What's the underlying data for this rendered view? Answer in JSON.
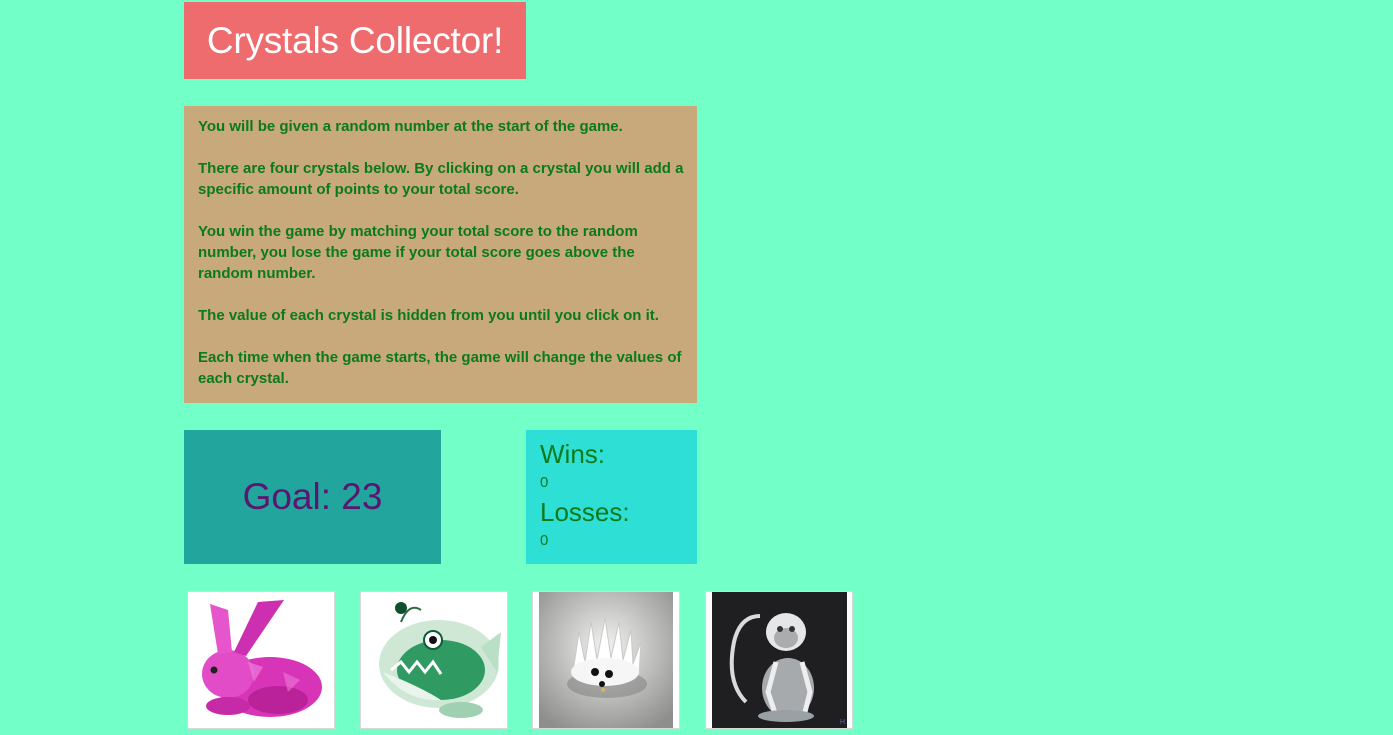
{
  "header": {
    "title": "Crystals Collector!"
  },
  "instructions": [
    "You will be given a random number at the start of the game.",
    "There are four crystals below. By clicking on a crystal you will add a specific amount of points to your total score.",
    "You win the game by matching your total score to the random number, you lose the game if your total score goes above the random number.",
    "The value of each crystal is hidden from you until you click on it.",
    "Each time when the game starts, the game will change the values of each crystal."
  ],
  "goal": {
    "text": "Goal: 23"
  },
  "scoreboard": {
    "wins_label": "Wins:",
    "wins_value": "0",
    "losses_label": "Losses:",
    "losses_value": "0"
  },
  "crystals": [
    {
      "name": "pink-rabbit-crystal",
      "color": "#e23fc3"
    },
    {
      "name": "green-fish-crystal",
      "color": "#2f9a62"
    },
    {
      "name": "clear-hedgehog-crystal",
      "color": "#d8d8d8"
    },
    {
      "name": "clear-monkey-crystal",
      "color": "#bfc3c6"
    }
  ],
  "colors": {
    "background": "#72ffc8",
    "title_bg": "#ee6b6e",
    "instructions_bg": "#c8a97c",
    "goal_bg": "#22a59d",
    "score_bg": "#2edfd6",
    "text_green": "#0b7a1a",
    "goal_text": "#5a1670"
  }
}
